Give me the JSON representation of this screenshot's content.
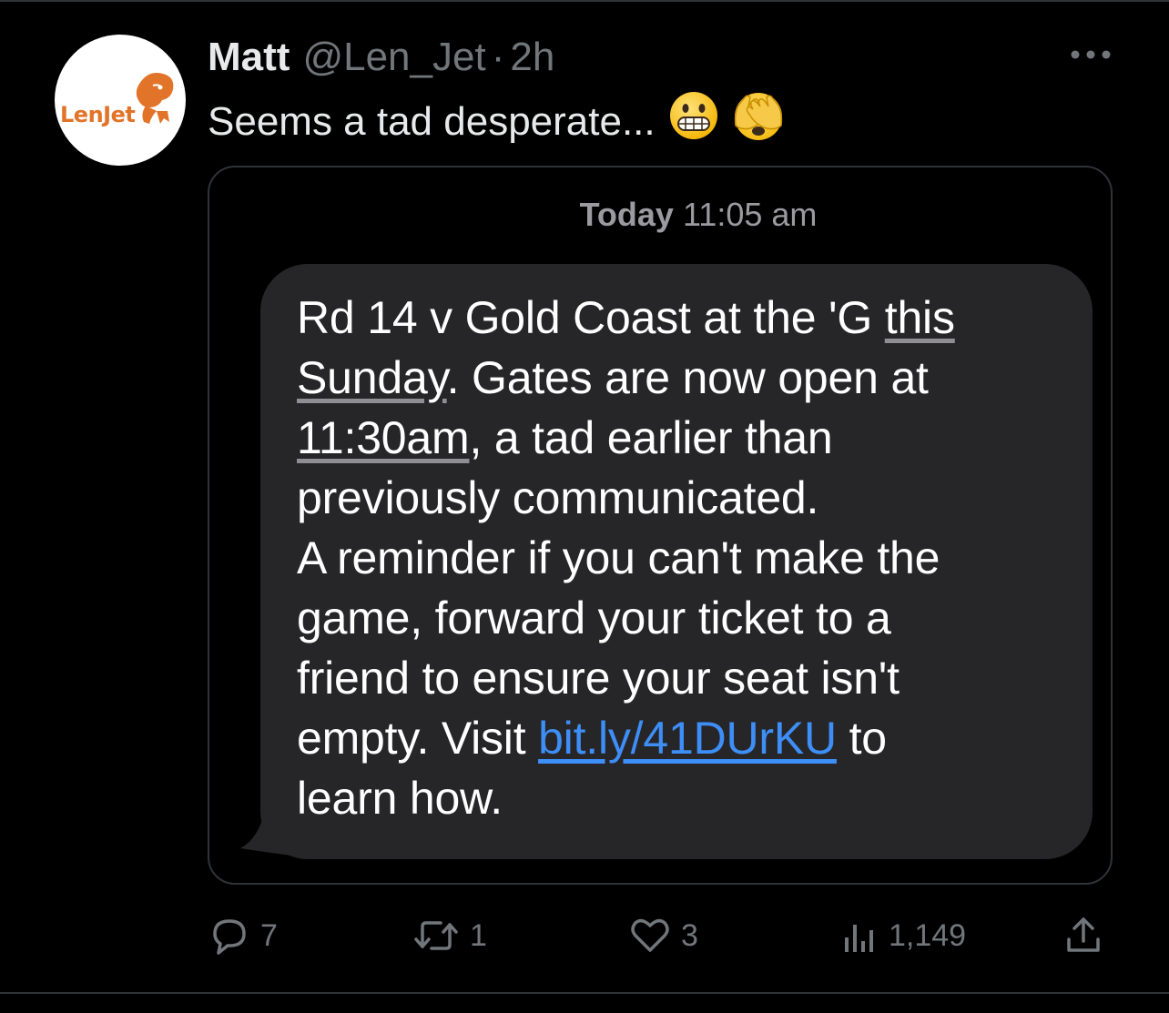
{
  "tweet": {
    "display_name": "Matt",
    "handle": "@Len_Jet",
    "separator": "·",
    "time": "2h",
    "text": "Seems a tad desperate...",
    "emojis": [
      "grimacing-face",
      "face-with-hand-over-eyes"
    ],
    "avatar_label": "LenJet"
  },
  "message": {
    "timestamp_day": "Today",
    "timestamp_time": "11:05 am",
    "lines": {
      "l1_plain": "Rd 14 v Gold Coast at the 'G ",
      "l1_link": "this",
      "l2_link": "Sunday",
      "l2_plain": ". Gates are now open at",
      "l3_link": "11:30am",
      "l3_plain": ", a tad earlier than",
      "l4": "previously communicated.",
      "l5": "A reminder if you can't make the",
      "l6": "game, forward your ticket to a",
      "l7": "friend to ensure your seat isn't",
      "l8_plain": "empty. Visit ",
      "l8_url": "bit.ly/41DUrKU",
      "l8_tail": " to",
      "l9": "learn how."
    }
  },
  "actions": {
    "replies": "7",
    "reposts": "1",
    "likes": "3",
    "views": "1,149"
  },
  "colors": {
    "background": "#000000",
    "text_primary": "#e7e9ea",
    "text_secondary": "#71767b",
    "bubble": "#262628",
    "link": "#3e8ef7",
    "logo_orange": "#e2742a"
  }
}
